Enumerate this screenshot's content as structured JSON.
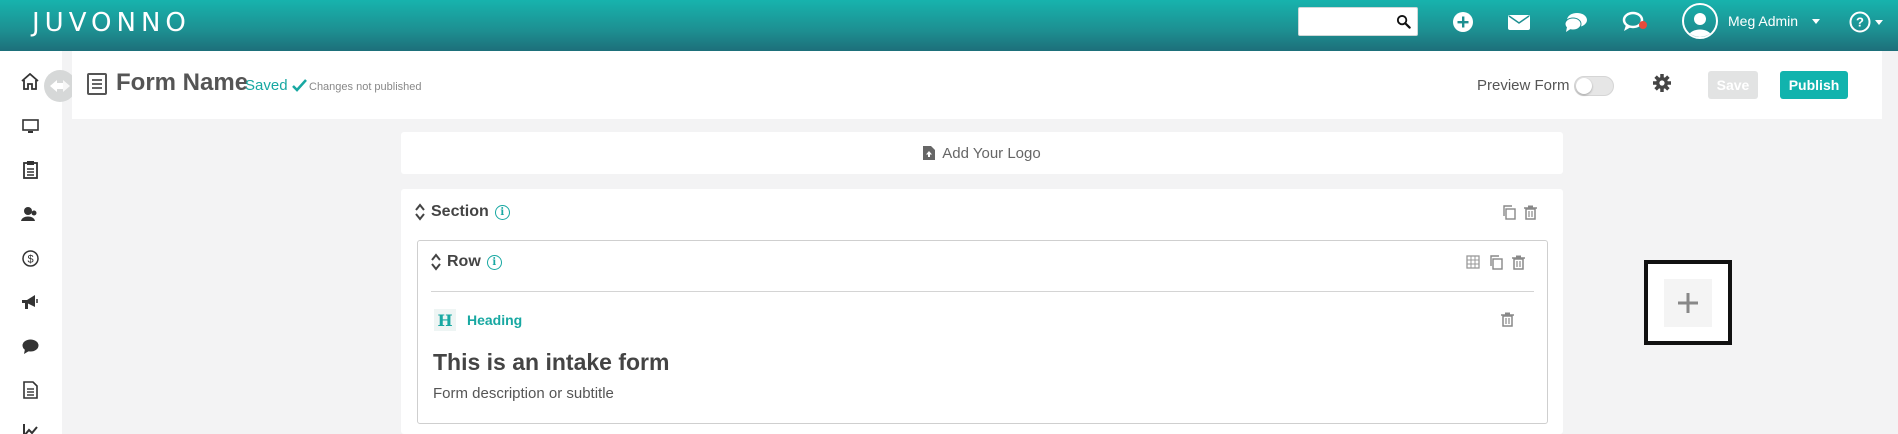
{
  "app": {
    "brand": "JUVONNO"
  },
  "topbar": {
    "search_placeholder": "",
    "icons": [
      "search-icon",
      "add-circle-icon",
      "mail-icon",
      "chat-icon",
      "notifications-chat-icon"
    ],
    "user_name": "Meg Admin"
  },
  "sidebar": {
    "items": [
      "home-icon",
      "monitor-icon",
      "clipboard-icon",
      "clients-icon",
      "billing-icon",
      "marketing-icon",
      "messages-icon",
      "documents-icon",
      "reports-icon"
    ]
  },
  "header": {
    "form_name": "Form Name",
    "saved_label": "Saved",
    "publish_status": "Changes not published",
    "preview_label": "Preview Form",
    "save_label": "Save",
    "publish_label": "Publish"
  },
  "content": {
    "add_logo_label": "Add Your Logo",
    "section_title": "Section",
    "row_title": "Row",
    "block_type_label": "Heading",
    "block_type_badge": "H",
    "form_heading": "This is an intake form",
    "form_subtitle": "Form description or subtitle"
  },
  "colors": {
    "accent": "#18a8a2",
    "topbar": "#1d8f91",
    "notification": "#e74c3c"
  }
}
